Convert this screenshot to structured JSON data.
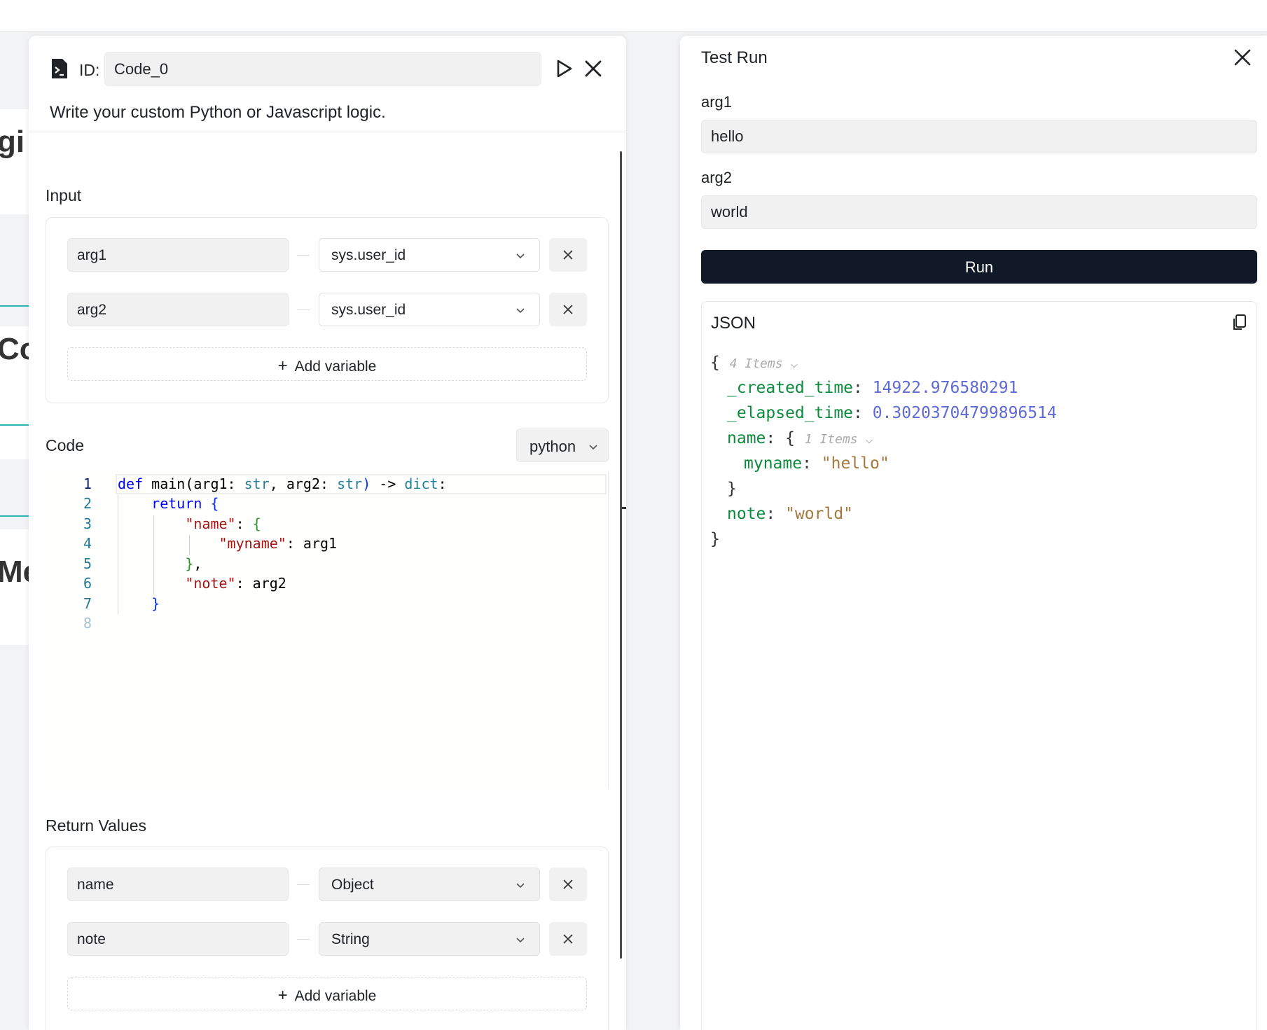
{
  "code_node": {
    "id_label": "ID:",
    "id_value": "Code_0",
    "description": "Write your custom Python or Javascript logic.",
    "input_title": "Input",
    "inputs": [
      {
        "name": "arg1",
        "source": "sys.user_id"
      },
      {
        "name": "arg2",
        "source": "sys.user_id"
      }
    ],
    "add_variable": "Add variable",
    "code_title": "Code",
    "language": "python",
    "line_numbers": [
      "1",
      "2",
      "3",
      "4",
      "5",
      "6",
      "7",
      "8"
    ],
    "return_title": "Return Values",
    "returns": [
      {
        "name": "name",
        "type": "Object"
      },
      {
        "name": "note",
        "type": "String"
      }
    ]
  },
  "background_nodes": [
    "gi",
    "Co",
    "Me"
  ],
  "test_run": {
    "title": "Test Run",
    "fields": [
      {
        "label": "arg1",
        "value": "hello"
      },
      {
        "label": "arg2",
        "value": "world"
      }
    ],
    "run_label": "Run",
    "json_title": "JSON",
    "json": {
      "root_count": "4 Items",
      "created_time_key": "_created_time",
      "created_time_value": "14922.976580291",
      "elapsed_time_key": "_elapsed_time",
      "elapsed_time_value": "0.30203704799896514",
      "name_key": "name",
      "name_count": "1 Items",
      "myname_key": "myname",
      "myname_value": "\"hello\"",
      "note_key": "note",
      "note_value": "\"world\""
    }
  },
  "colors": {
    "run_button": "#111827",
    "json_key": "#0e8a3e",
    "json_number": "#5f6ad6",
    "json_string": "#a5793d"
  }
}
